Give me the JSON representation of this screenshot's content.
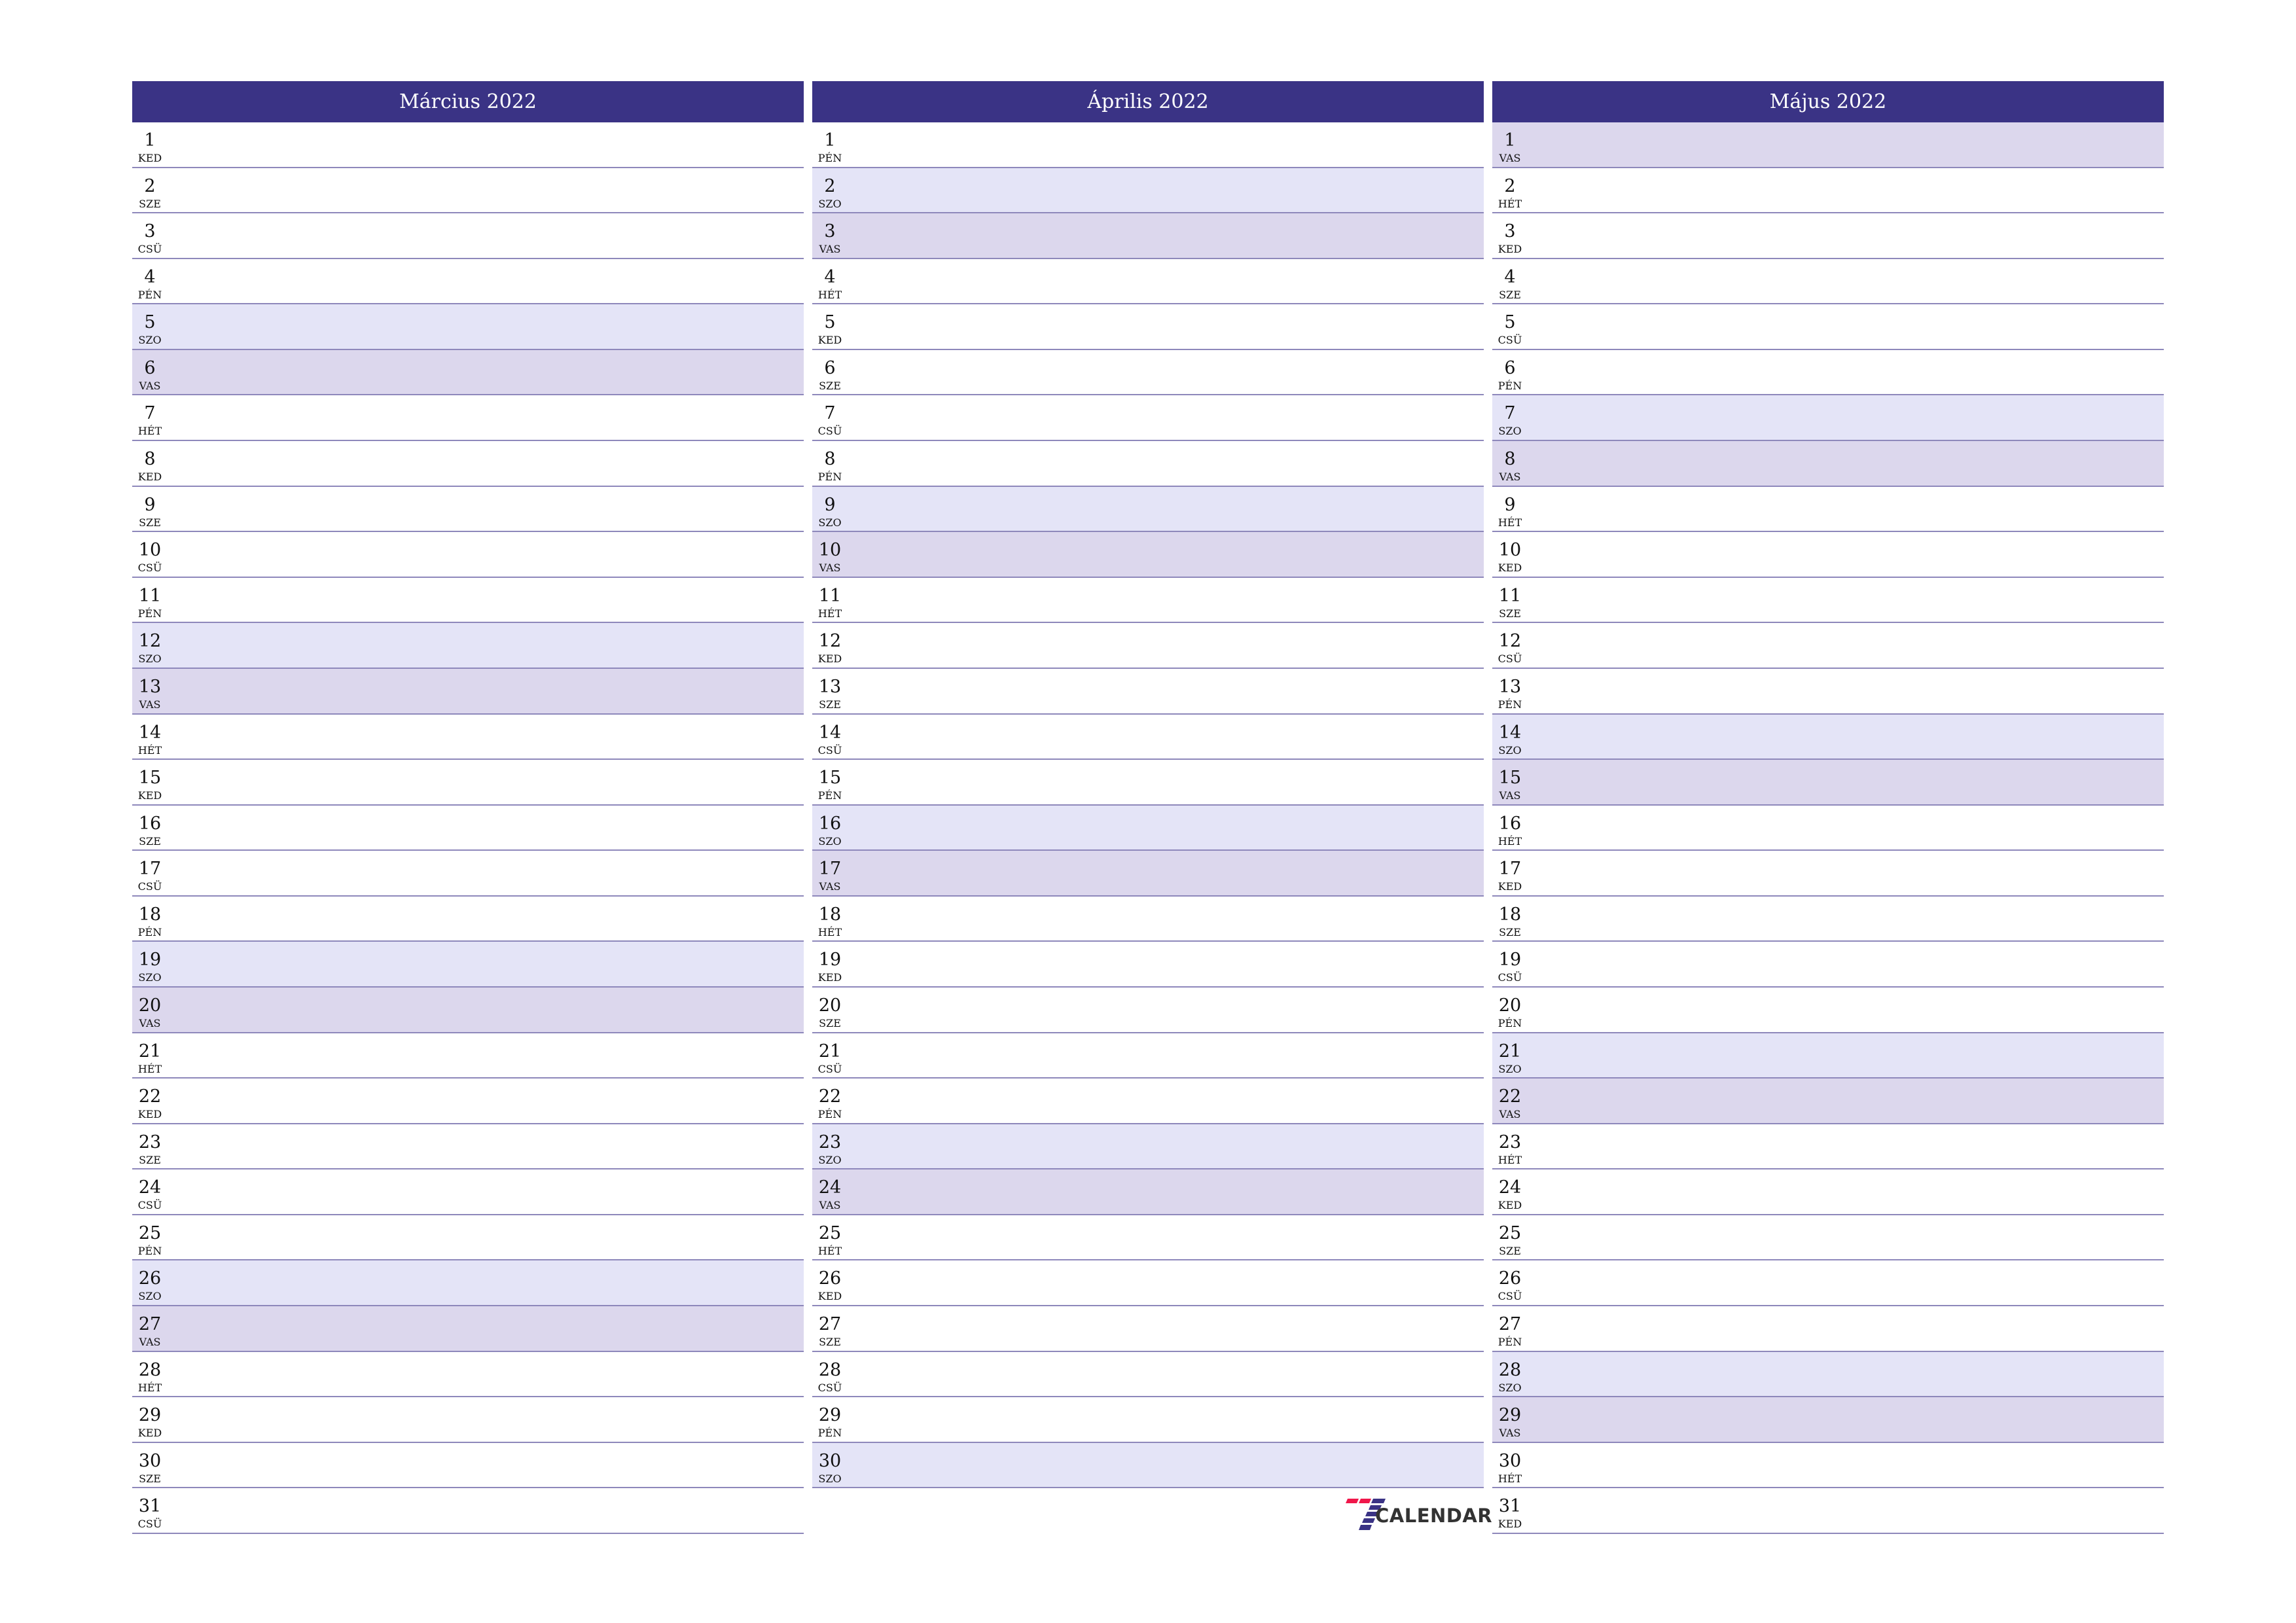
{
  "colors": {
    "header_bg": "#3a3385",
    "header_text": "#ffffff",
    "saturday_bg": "#e4e4f7",
    "sunday_bg": "#dcd7ed",
    "row_border": "#8e88bb",
    "logo_red": "#f0174a",
    "logo_blue": "#3a3385"
  },
  "months": [
    {
      "title": "Március 2022",
      "days": [
        {
          "n": "1",
          "d": "KED"
        },
        {
          "n": "2",
          "d": "SZE"
        },
        {
          "n": "3",
          "d": "CSÜ"
        },
        {
          "n": "4",
          "d": "PÉN"
        },
        {
          "n": "5",
          "d": "SZO"
        },
        {
          "n": "6",
          "d": "VAS"
        },
        {
          "n": "7",
          "d": "HÉT"
        },
        {
          "n": "8",
          "d": "KED"
        },
        {
          "n": "9",
          "d": "SZE"
        },
        {
          "n": "10",
          "d": "CSÜ"
        },
        {
          "n": "11",
          "d": "PÉN"
        },
        {
          "n": "12",
          "d": "SZO"
        },
        {
          "n": "13",
          "d": "VAS"
        },
        {
          "n": "14",
          "d": "HÉT"
        },
        {
          "n": "15",
          "d": "KED"
        },
        {
          "n": "16",
          "d": "SZE"
        },
        {
          "n": "17",
          "d": "CSÜ"
        },
        {
          "n": "18",
          "d": "PÉN"
        },
        {
          "n": "19",
          "d": "SZO"
        },
        {
          "n": "20",
          "d": "VAS"
        },
        {
          "n": "21",
          "d": "HÉT"
        },
        {
          "n": "22",
          "d": "KED"
        },
        {
          "n": "23",
          "d": "SZE"
        },
        {
          "n": "24",
          "d": "CSÜ"
        },
        {
          "n": "25",
          "d": "PÉN"
        },
        {
          "n": "26",
          "d": "SZO"
        },
        {
          "n": "27",
          "d": "VAS"
        },
        {
          "n": "28",
          "d": "HÉT"
        },
        {
          "n": "29",
          "d": "KED"
        },
        {
          "n": "30",
          "d": "SZE"
        },
        {
          "n": "31",
          "d": "CSÜ"
        }
      ]
    },
    {
      "title": "Április 2022",
      "days": [
        {
          "n": "1",
          "d": "PÉN"
        },
        {
          "n": "2",
          "d": "SZO"
        },
        {
          "n": "3",
          "d": "VAS"
        },
        {
          "n": "4",
          "d": "HÉT"
        },
        {
          "n": "5",
          "d": "KED"
        },
        {
          "n": "6",
          "d": "SZE"
        },
        {
          "n": "7",
          "d": "CSÜ"
        },
        {
          "n": "8",
          "d": "PÉN"
        },
        {
          "n": "9",
          "d": "SZO"
        },
        {
          "n": "10",
          "d": "VAS"
        },
        {
          "n": "11",
          "d": "HÉT"
        },
        {
          "n": "12",
          "d": "KED"
        },
        {
          "n": "13",
          "d": "SZE"
        },
        {
          "n": "14",
          "d": "CSÜ"
        },
        {
          "n": "15",
          "d": "PÉN"
        },
        {
          "n": "16",
          "d": "SZO"
        },
        {
          "n": "17",
          "d": "VAS"
        },
        {
          "n": "18",
          "d": "HÉT"
        },
        {
          "n": "19",
          "d": "KED"
        },
        {
          "n": "20",
          "d": "SZE"
        },
        {
          "n": "21",
          "d": "CSÜ"
        },
        {
          "n": "22",
          "d": "PÉN"
        },
        {
          "n": "23",
          "d": "SZO"
        },
        {
          "n": "24",
          "d": "VAS"
        },
        {
          "n": "25",
          "d": "HÉT"
        },
        {
          "n": "26",
          "d": "KED"
        },
        {
          "n": "27",
          "d": "SZE"
        },
        {
          "n": "28",
          "d": "CSÜ"
        },
        {
          "n": "29",
          "d": "PÉN"
        },
        {
          "n": "30",
          "d": "SZO"
        }
      ]
    },
    {
      "title": "Május 2022",
      "days": [
        {
          "n": "1",
          "d": "VAS"
        },
        {
          "n": "2",
          "d": "HÉT"
        },
        {
          "n": "3",
          "d": "KED"
        },
        {
          "n": "4",
          "d": "SZE"
        },
        {
          "n": "5",
          "d": "CSÜ"
        },
        {
          "n": "6",
          "d": "PÉN"
        },
        {
          "n": "7",
          "d": "SZO"
        },
        {
          "n": "8",
          "d": "VAS"
        },
        {
          "n": "9",
          "d": "HÉT"
        },
        {
          "n": "10",
          "d": "KED"
        },
        {
          "n": "11",
          "d": "SZE"
        },
        {
          "n": "12",
          "d": "CSÜ"
        },
        {
          "n": "13",
          "d": "PÉN"
        },
        {
          "n": "14",
          "d": "SZO"
        },
        {
          "n": "15",
          "d": "VAS"
        },
        {
          "n": "16",
          "d": "HÉT"
        },
        {
          "n": "17",
          "d": "KED"
        },
        {
          "n": "18",
          "d": "SZE"
        },
        {
          "n": "19",
          "d": "CSÜ"
        },
        {
          "n": "20",
          "d": "PÉN"
        },
        {
          "n": "21",
          "d": "SZO"
        },
        {
          "n": "22",
          "d": "VAS"
        },
        {
          "n": "23",
          "d": "HÉT"
        },
        {
          "n": "24",
          "d": "KED"
        },
        {
          "n": "25",
          "d": "SZE"
        },
        {
          "n": "26",
          "d": "CSÜ"
        },
        {
          "n": "27",
          "d": "PÉN"
        },
        {
          "n": "28",
          "d": "SZO"
        },
        {
          "n": "29",
          "d": "VAS"
        },
        {
          "n": "30",
          "d": "HÉT"
        },
        {
          "n": "31",
          "d": "KED"
        }
      ]
    }
  ],
  "weekend": {
    "saturday": "SZO",
    "sunday": "VAS"
  },
  "logo": {
    "icon": "seven-calendar-logo-icon",
    "text": "CALENDAR"
  }
}
